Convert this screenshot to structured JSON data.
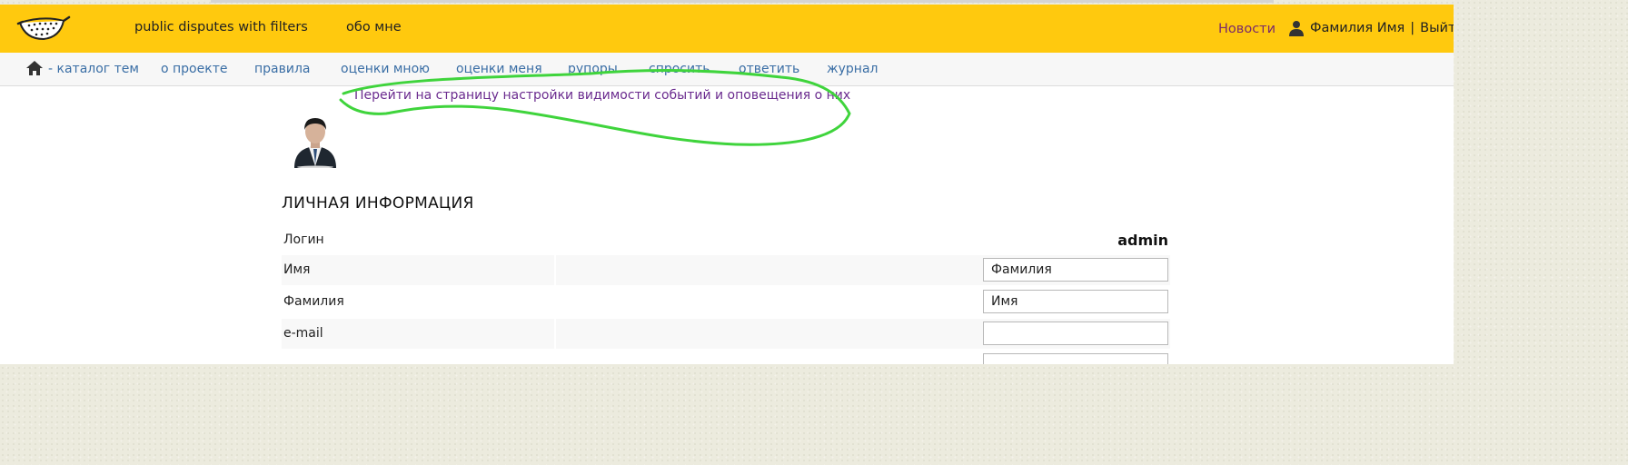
{
  "header": {
    "title": "public disputes with filters",
    "about_me": "обо мне",
    "news": "Новости",
    "user_name": "Фамилия Имя",
    "separator": "|",
    "logout": "Выйти"
  },
  "nav": {
    "items": [
      {
        "label": "- каталог тем"
      },
      {
        "label": "о проекте"
      },
      {
        "label": "правила"
      },
      {
        "label": "оценки мною"
      },
      {
        "label": "оценки меня"
      },
      {
        "label": "рупоры"
      },
      {
        "label": "спросить"
      },
      {
        "label": "ответить"
      },
      {
        "label": "журнал"
      }
    ]
  },
  "profile": {
    "settings_link": "Перейти на страницу настройки видимости событий и оповещения о них",
    "section_title": "ЛИЧНАЯ ИНФОРМАЦИЯ",
    "fields": [
      {
        "label": "Логин",
        "value": "admin"
      },
      {
        "label": "Имя",
        "value": "Фамилия"
      },
      {
        "label": "Фамилия",
        "value": "Имя"
      },
      {
        "label": "e-mail",
        "value": ""
      },
      {
        "label": "",
        "value": ""
      }
    ]
  },
  "icons": {
    "logo": "colander-logo-icon",
    "user": "user-icon",
    "home": "home-icon",
    "avatar": "businessman-avatar-icon"
  },
  "colors": {
    "header_bg": "#ffc90e",
    "nav_link": "#3a6ea5",
    "visited_link": "#6b2c8f",
    "annotation": "#3fd43c"
  }
}
